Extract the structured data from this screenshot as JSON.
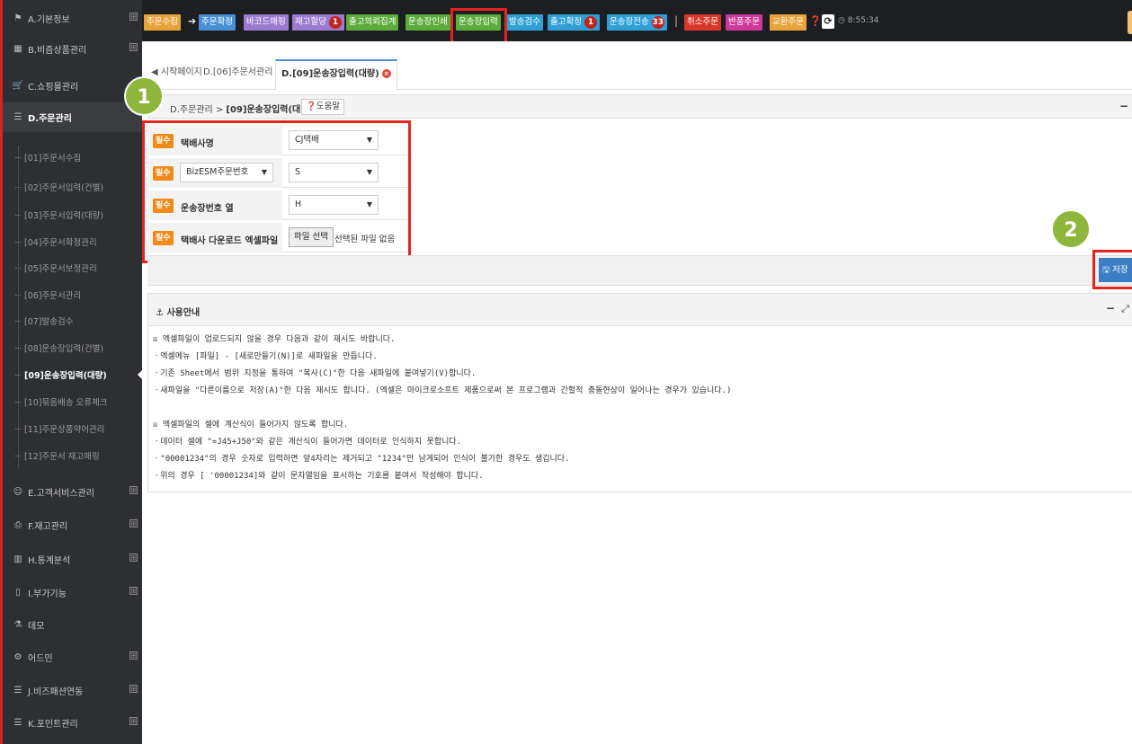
{
  "sidebar": {
    "items": [
      {
        "icon": "flag-icon",
        "label": "A.기본정보",
        "expand": "⊞"
      },
      {
        "icon": "barcode-icon",
        "label": "B.비즘상품관리",
        "expand": "⊞"
      },
      {
        "icon": "cart-icon",
        "label": "C.쇼핑몰관리",
        "expand": "⊞"
      },
      {
        "icon": "list-icon",
        "label": "D.주문관리",
        "expand": ""
      },
      {
        "icon": "smile-icon",
        "label": "E.고객서비스관리",
        "expand": "⊞"
      },
      {
        "icon": "printer-icon",
        "label": "F.재고관리",
        "expand": "⊞"
      },
      {
        "icon": "chart-icon",
        "label": "H.통계분석",
        "expand": "⊞"
      },
      {
        "icon": "bookmark-icon",
        "label": "I.부가기능",
        "expand": "⊞"
      },
      {
        "icon": "flask-icon",
        "label": "데모",
        "expand": ""
      },
      {
        "icon": "gears-icon",
        "label": "어드민",
        "expand": "⊞"
      },
      {
        "icon": "list-icon",
        "label": "J.비즈패션연동",
        "expand": "⊞"
      },
      {
        "icon": "list-icon",
        "label": "K.포인트관리",
        "expand": "⊞"
      }
    ],
    "sub_items": [
      "[01]주문서수집",
      "[02]주문서입력(건별)",
      "[03]주문서입력(대량)",
      "[04]주문서확정관리",
      "[05]주문서보정관리",
      "[06]주문서관리",
      "[07]발송검수",
      "[08]운송장입력(건별)",
      "[09]운송장입력(대량)",
      "[10]묶음배송 오류체크",
      "[11]주문상품약어관리",
      "[12]주문서 재고매핑"
    ]
  },
  "topbar": {
    "buttons": [
      {
        "label": "주문수집",
        "color": "#e8a33a",
        "count": ""
      },
      {
        "label": "주문확정",
        "color": "#4a8fd6",
        "count": ""
      },
      {
        "label": "바코드매핑",
        "color": "#9b7ad0",
        "count": ""
      },
      {
        "label": "재고할당",
        "color": "#9b7ad0",
        "count": "1"
      },
      {
        "label": "출고의뢰집계",
        "color": "#5cab3c",
        "count": ""
      },
      {
        "label": "운송장인쇄",
        "color": "#5cab3c",
        "count": ""
      },
      {
        "label": "운송장입력",
        "color": "#5cab3c",
        "count": ""
      },
      {
        "label": "발송검수",
        "color": "#2f9fd8",
        "count": ""
      },
      {
        "label": "출고확정",
        "color": "#2f9fd8",
        "count": "1"
      },
      {
        "label": "운송장전송",
        "color": "#2f9fd8",
        "count": "33"
      },
      {
        "label": "취소주문",
        "color": "#d9362b",
        "count": ""
      },
      {
        "label": "반품주문",
        "color": "#d0379a",
        "count": ""
      },
      {
        "label": "교환주문",
        "color": "#e8a33a",
        "count": ""
      }
    ],
    "arrow": "➔",
    "separator": "|",
    "help": "❓",
    "refresh": "⟳",
    "clock": "◷ 8:55:34"
  },
  "tabs": [
    {
      "label": "◀ 시작페이지",
      "close": ""
    },
    {
      "label": "D.[06]주문서관리",
      "close": "×"
    },
    {
      "label": "D.[09]운송장입력(대량)",
      "close": "×"
    }
  ],
  "breadcrumb": {
    "path": "D.주문관리 > ",
    "current": "[09]운송장입력(대량)",
    "help": "❓도움말",
    "minimize": "−"
  },
  "form": {
    "required_badge": "필수",
    "courier": {
      "label": "택배사명",
      "value": "CJ택배"
    },
    "order_no": {
      "label_select": "BizESM주문번호",
      "value": "S"
    },
    "waybill_col": {
      "label": "운송장번호 열",
      "value": "H"
    },
    "file": {
      "label": "택배사 다운로드 엑셀파일",
      "button": "파일 선택",
      "status": "선택된 파일 없음"
    }
  },
  "save_button": "🖫 저장",
  "guide": {
    "title": "⚓ 사용안내",
    "minimize": "−",
    "expand": "⤢",
    "lines": [
      "☒ 엑셀파일이 업로드되지 않을 경우 다음과 같이 재시도 바랍니다.",
      "ㆍ엑셀메뉴 [파일] - [새로만들기(N)]로 새파일을 만듭니다.",
      "ㆍ기존 Sheet에서 범위 지정을 통하여 \"복사(C)\"한 다음 새파일에 붙여넣기(V)합니다.",
      "ㆍ새파일을 \"다른이름으로 저장(A)\"한 다음 재시도 합니다. (엑셀은 마이크로소프트 제품으로써 본 프로그램과 간헐적 충돌현상이 일어나는 경우가 있습니다.)",
      "",
      "☒ 엑셀파일의 셀에 계산식이 들어가지 않도록 합니다.",
      "ㆍ데이터 셀에 \"=J45+J50\"와 같은 계산식이 들어가면 데이터로 인식하지 못합니다.",
      "ㆍ\"00001234\"의 경우 숫자로 입력하면 앞4자리는 제거되고 \"1234\"만 남게되어 인식이 불가한 경우도 생깁니다.",
      "ㆍ위의 경우 [ '00001234]와 같이 문자열임을 표시하는 기호를 붙여서 작성해야 합니다."
    ]
  },
  "callouts": [
    "1",
    "2"
  ]
}
